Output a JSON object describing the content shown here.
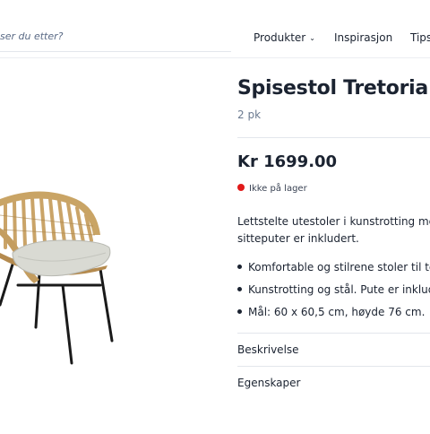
{
  "header": {
    "search_placeholder": "ser du etter?",
    "nav": [
      {
        "label": "Produkter",
        "chevron": "chevron-down-icon"
      },
      {
        "label": "Inspirasjon"
      },
      {
        "label": "Tips"
      }
    ]
  },
  "product": {
    "title": "Spisestol Tretoria",
    "subtitle": "2 pk",
    "price": "Kr 1699.00",
    "stock": {
      "label": "Ikke på lager",
      "color": "#e11a1a"
    },
    "description_lines": [
      "Lettstelte utestoler i kunstrotting me",
      "sitteputer er inkludert."
    ],
    "bullets": [
      "Komfortable og stilrene stoler til te",
      "Kunstrotting og stål. Pute er inklud",
      "Mål: 60 x 60,5 cm, høyde 76 cm."
    ],
    "accordions": [
      {
        "label": "Beskrivelse"
      },
      {
        "label": "Egenskaper"
      }
    ]
  }
}
